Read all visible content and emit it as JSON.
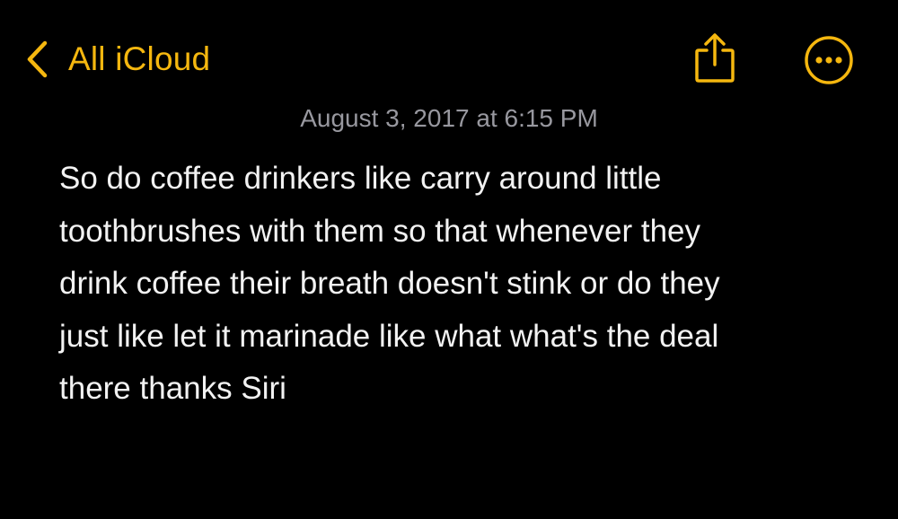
{
  "nav": {
    "back_label": "All iCloud",
    "back_icon": "chevron-left-icon",
    "share_icon": "share-icon",
    "more_icon": "ellipsis-circle-icon"
  },
  "note": {
    "date": "August 3, 2017 at 6:15 PM",
    "body": "So do coffee drinkers like carry around little\ntoothbrushes with them so that whenever they\ndrink coffee their breath doesn't stink or do they\njust like let it marinade like what what's the deal\nthere thanks Siri"
  },
  "colors": {
    "background": "#000000",
    "accent": "#F5B70F",
    "date_text": "#98989F",
    "body_text": "#F2F2F2"
  }
}
